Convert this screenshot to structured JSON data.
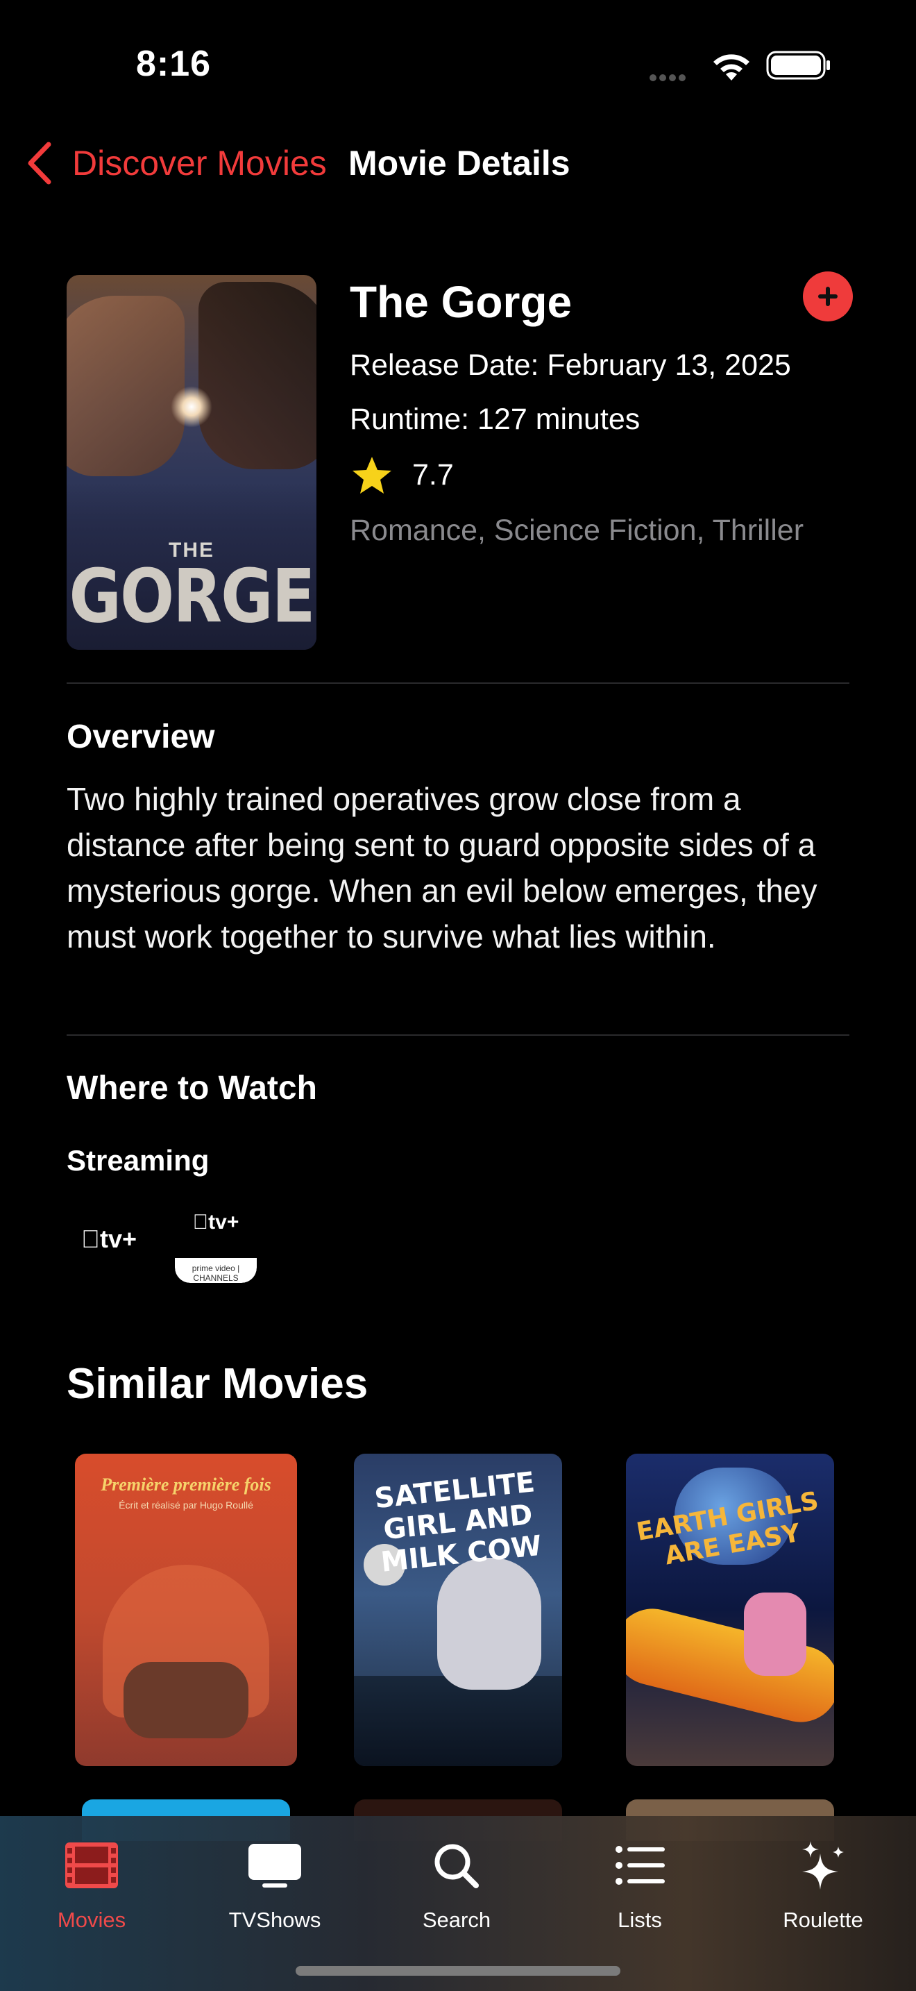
{
  "status_bar": {
    "time": "8:16",
    "wifi_icon": "wifi-icon",
    "battery_icon": "battery-icon"
  },
  "nav": {
    "back_label": "Discover Movies",
    "title": "Movie Details",
    "back_icon": "chevron-left-icon",
    "accent_color": "#f23b3b"
  },
  "movie": {
    "poster_title_small": "THE",
    "poster_title_large": "GORGE",
    "title": "The Gorge",
    "release": "Release Date: February 13, 2025",
    "runtime": "Runtime: 127 minutes",
    "rating": "7.7",
    "genres": "Romance, Science Fiction, Thriller",
    "add_icon": "plus-circle-icon"
  },
  "overview": {
    "heading": "Overview",
    "text": "Two highly trained operatives grow close from a distance after being sent to guard opposite sides of a mysterious gorge. When an evil below emerges, they must work together to survive what lies within."
  },
  "where_to_watch": {
    "heading": "Where to Watch",
    "streaming_heading": "Streaming",
    "providers": [
      {
        "label": "tv+",
        "name": "Apple TV+"
      },
      {
        "label": "tv+",
        "sub": "prime video | CHANNELS",
        "name": "Apple TV+ Amazon Channel"
      }
    ]
  },
  "similar": {
    "heading": "Similar Movies",
    "movies": [
      {
        "poster_title": "Première première fois",
        "poster_sub": "Écrit et réalisé par Hugo Roullé"
      },
      {
        "poster_title": "SATELLITE GIRL AND MILK COW"
      },
      {
        "poster_title": "EARTH GIRLS ARE EASY"
      }
    ]
  },
  "tabbar": {
    "active_color": "#f04a4a",
    "tabs": [
      {
        "label": "Movies",
        "icon": "film-icon"
      },
      {
        "label": "TVShows",
        "icon": "tv-icon"
      },
      {
        "label": "Search",
        "icon": "search-icon"
      },
      {
        "label": "Lists",
        "icon": "list-icon"
      },
      {
        "label": "Roulette",
        "icon": "sparkles-icon"
      }
    ]
  }
}
